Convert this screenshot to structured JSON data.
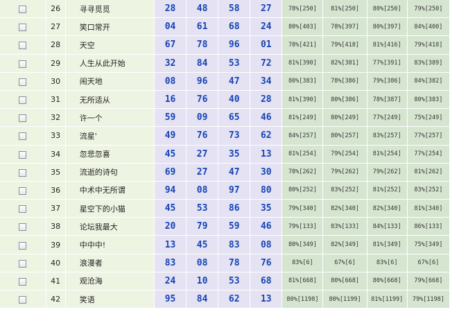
{
  "rows": [
    {
      "no": "26",
      "name": "寻寻觅觅",
      "nums": [
        "28",
        "48",
        "58",
        "27"
      ],
      "pcts": [
        "78%[250]",
        "81%[250]",
        "80%[250]",
        "79%[250]"
      ]
    },
    {
      "no": "27",
      "name": "笑口常开",
      "nums": [
        "04",
        "61",
        "68",
        "24"
      ],
      "pcts": [
        "80%[403]",
        "78%[397]",
        "80%[397]",
        "84%[400]"
      ]
    },
    {
      "no": "28",
      "name": "天空",
      "nums": [
        "67",
        "78",
        "96",
        "01"
      ],
      "pcts": [
        "78%[421]",
        "79%[418]",
        "81%[416]",
        "79%[418]"
      ]
    },
    {
      "no": "29",
      "name": "人生从此开始",
      "nums": [
        "32",
        "84",
        "53",
        "72"
      ],
      "pcts": [
        "81%[390]",
        "82%[381]",
        "77%[391]",
        "83%[389]"
      ]
    },
    {
      "no": "30",
      "name": "闹天地",
      "nums": [
        "08",
        "96",
        "47",
        "34"
      ],
      "pcts": [
        "80%[383]",
        "78%[386]",
        "79%[386]",
        "84%[382]"
      ]
    },
    {
      "no": "31",
      "name": "无所适从",
      "nums": [
        "16",
        "76",
        "40",
        "28"
      ],
      "pcts": [
        "81%[390]",
        "80%[386]",
        "78%[387]",
        "80%[383]"
      ]
    },
    {
      "no": "32",
      "name": "许一个",
      "nums": [
        "59",
        "09",
        "65",
        "46"
      ],
      "pcts": [
        "81%[249]",
        "80%[249]",
        "77%[249]",
        "75%[249]"
      ]
    },
    {
      "no": "33",
      "name": "流星'",
      "nums": [
        "49",
        "76",
        "73",
        "62"
      ],
      "pcts": [
        "84%[257]",
        "80%[257]",
        "83%[257]",
        "77%[257]"
      ]
    },
    {
      "no": "34",
      "name": "忽悲忽喜",
      "nums": [
        "45",
        "27",
        "35",
        "13"
      ],
      "pcts": [
        "81%[254]",
        "79%[254]",
        "81%[254]",
        "77%[254]"
      ]
    },
    {
      "no": "35",
      "name": "流逝的诗句",
      "nums": [
        "69",
        "27",
        "47",
        "30"
      ],
      "pcts": [
        "78%[262]",
        "79%[262]",
        "79%[262]",
        "81%[262]"
      ]
    },
    {
      "no": "36",
      "name": "中术中无所谓",
      "nums": [
        "94",
        "08",
        "97",
        "80"
      ],
      "pcts": [
        "80%[252]",
        "83%[252]",
        "81%[252]",
        "83%[252]"
      ]
    },
    {
      "no": "37",
      "name": "星空下的小猫",
      "nums": [
        "45",
        "53",
        "86",
        "35"
      ],
      "pcts": [
        "79%[340]",
        "82%[340]",
        "82%[340]",
        "81%[340]"
      ]
    },
    {
      "no": "38",
      "name": "论坛我最大",
      "nums": [
        "20",
        "79",
        "59",
        "46"
      ],
      "pcts": [
        "79%[133]",
        "83%[133]",
        "84%[133]",
        "86%[133]"
      ]
    },
    {
      "no": "39",
      "name": "中中中!",
      "nums": [
        "13",
        "45",
        "83",
        "08"
      ],
      "pcts": [
        "80%[349]",
        "82%[349]",
        "81%[349]",
        "75%[349]"
      ]
    },
    {
      "no": "40",
      "name": "浪漫者",
      "nums": [
        "83",
        "08",
        "78",
        "76"
      ],
      "pcts": [
        "83%[6]",
        "67%[6]",
        "83%[6]",
        "67%[6]"
      ]
    },
    {
      "no": "41",
      "name": "观沧海",
      "nums": [
        "24",
        "10",
        "53",
        "68"
      ],
      "pcts": [
        "81%[668]",
        "80%[668]",
        "80%[668]",
        "79%[668]"
      ]
    },
    {
      "no": "42",
      "name": "笑语",
      "nums": [
        "95",
        "84",
        "62",
        "13"
      ],
      "pcts": [
        "80%[1198]",
        "80%[1199]",
        "81%[1199]",
        "79%[1198]"
      ]
    }
  ]
}
